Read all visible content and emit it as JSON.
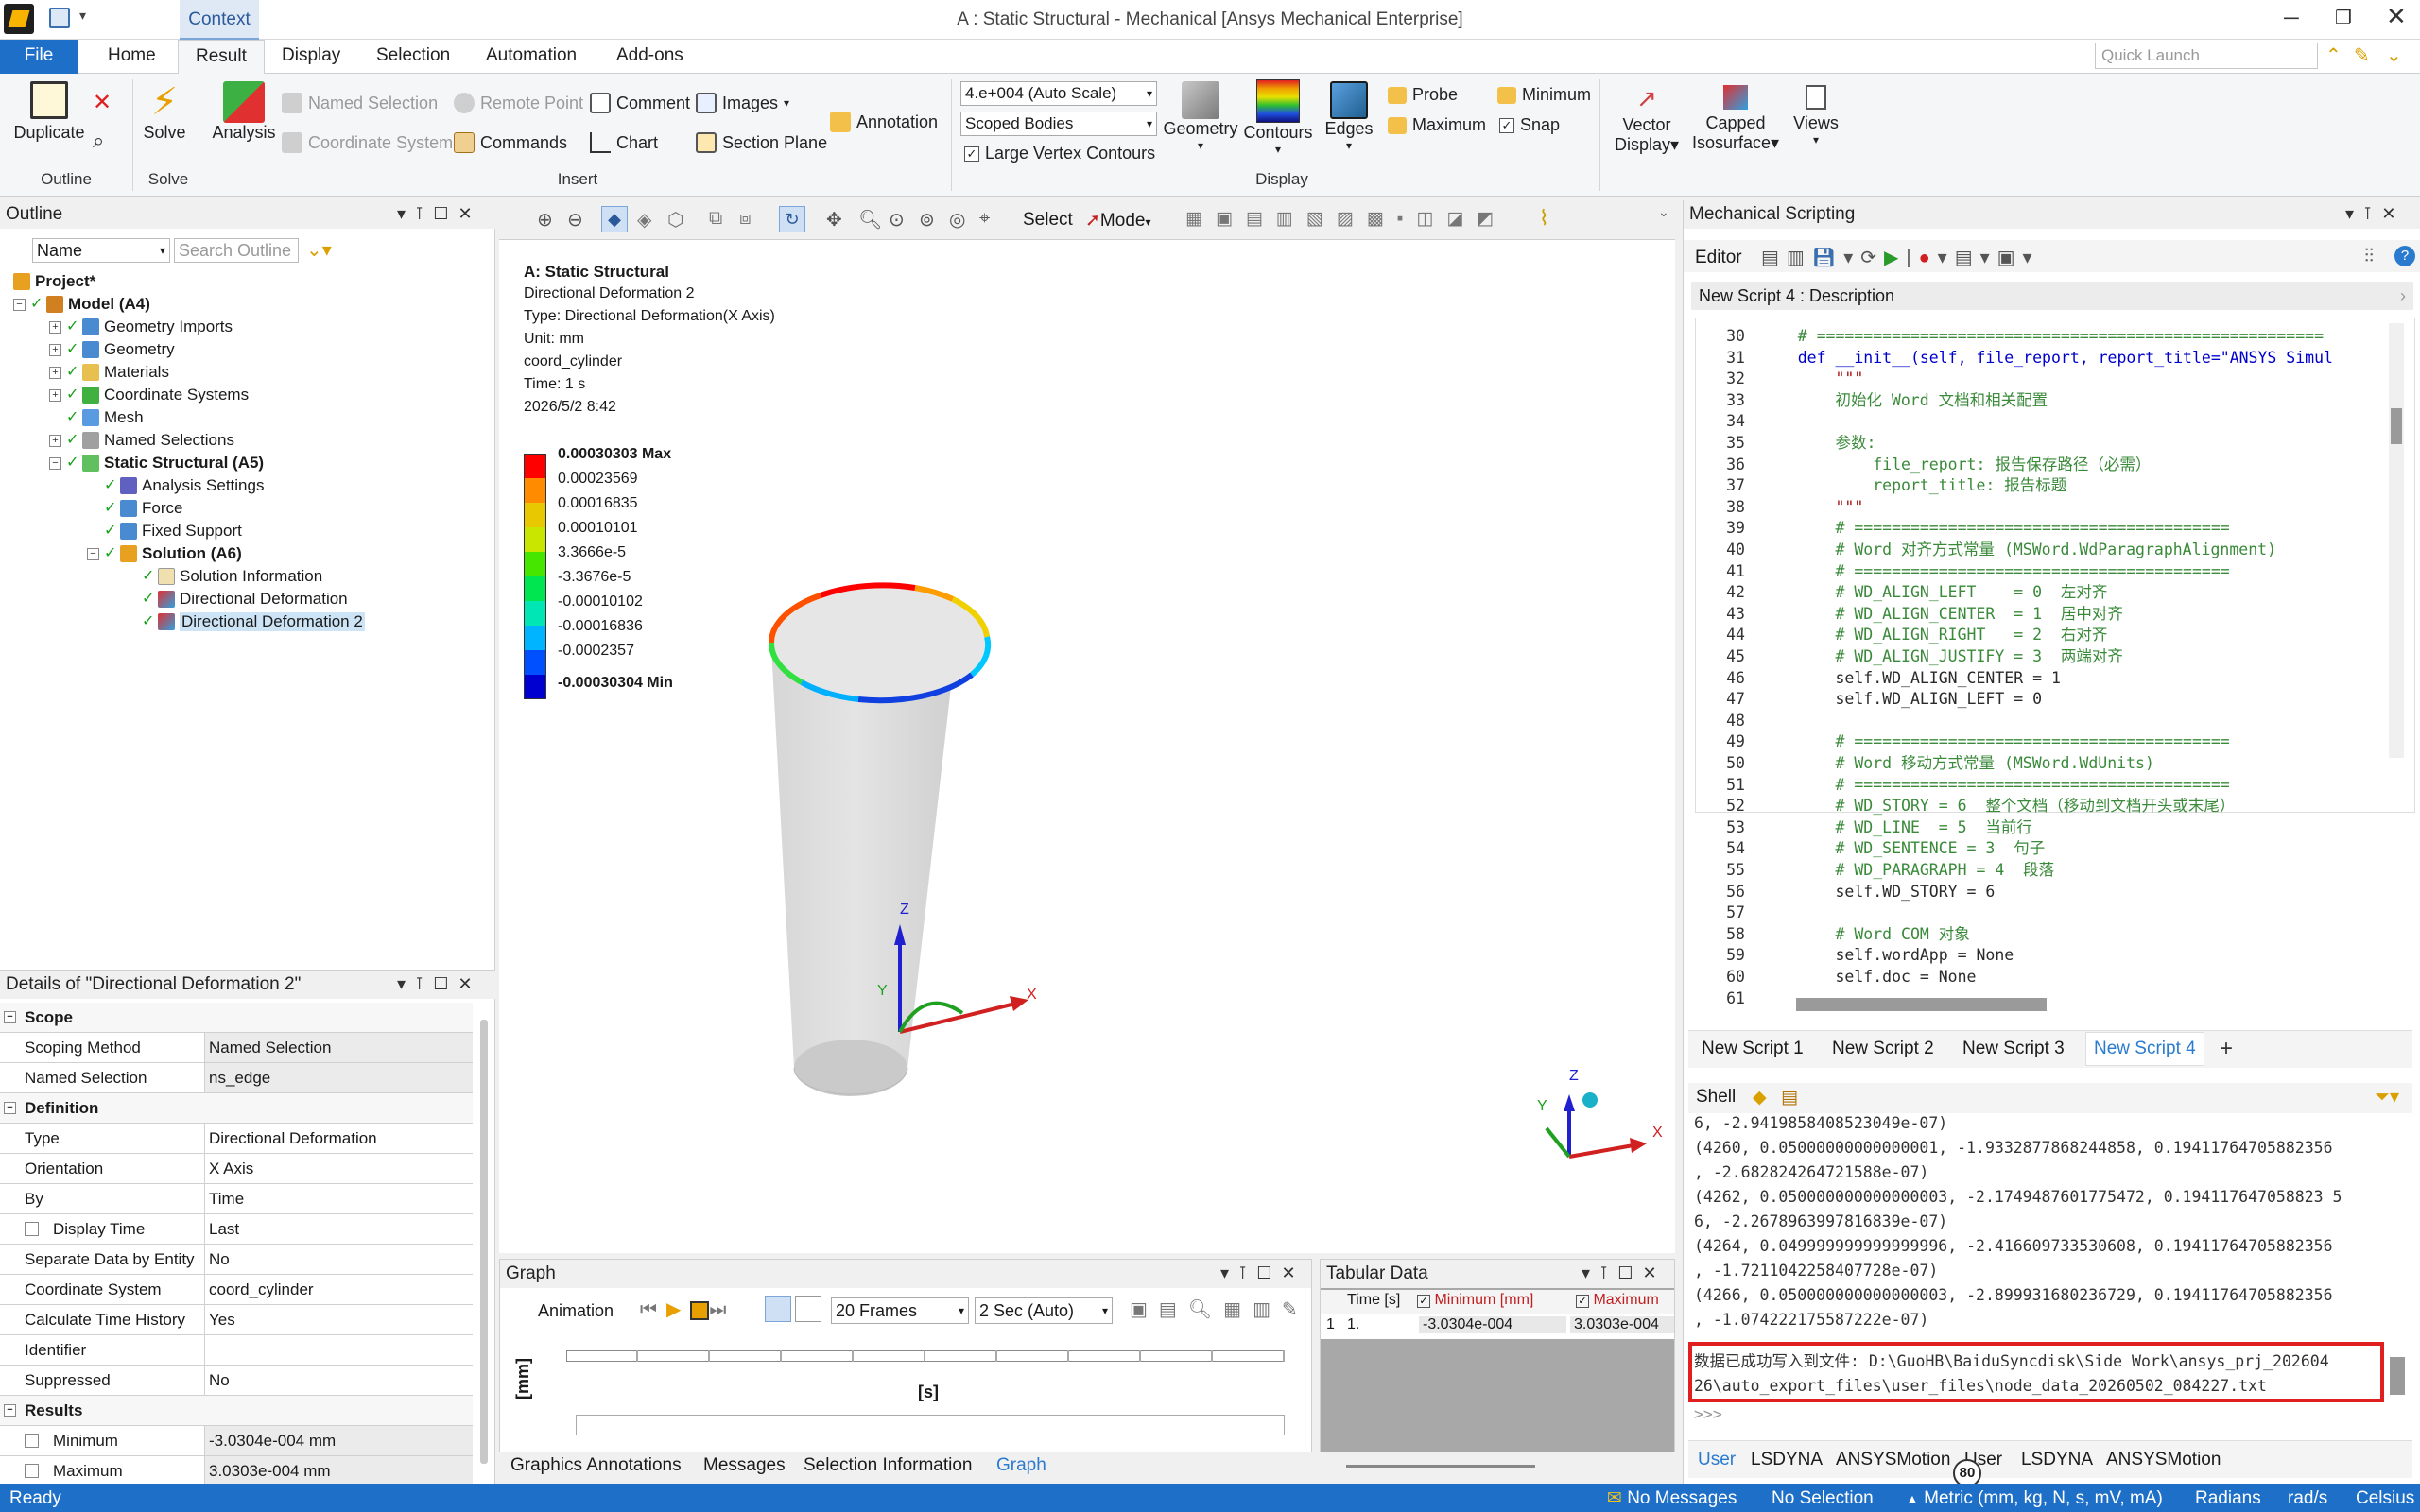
{
  "window": {
    "title": "A : Static Structural - Mechanical [Ansys Mechanical Enterprise]",
    "context_tab": "Context",
    "quick_launch_placeholder": "Quick Launch"
  },
  "ribbon_tabs": [
    "File",
    "Home",
    "Result",
    "Display",
    "Selection",
    "Automation",
    "Add-ons"
  ],
  "ribbon": {
    "duplicate": "Duplicate",
    "solve": "Solve",
    "analysis": "Analysis",
    "named_selection": "Named Selection",
    "coordinate_system": "Coordinate System",
    "remote_point": "Remote Point",
    "commands": "Commands",
    "comment": "Comment",
    "chart": "Chart",
    "images": "Images",
    "section_plane": "Section Plane",
    "annotation": "Annotation",
    "scale_value": "4.e+004 (Auto Scale)",
    "scope_value": "Scoped Bodies",
    "large_vertex": "Large Vertex Contours",
    "geometry": "Geometry",
    "contours": "Contours",
    "edges": "Edges",
    "probe": "Probe",
    "minimum": "Minimum",
    "maximum": "Maximum",
    "snap": "Snap",
    "vector_display_1": "Vector",
    "vector_display_2": "Display",
    "capped_1": "Capped",
    "capped_2": "Isosurface",
    "views": "Views",
    "groups": [
      "Outline",
      "Solve",
      "Insert",
      "Display"
    ]
  },
  "outline": {
    "title": "Outline",
    "filter_value": "Name",
    "search_placeholder": "Search Outline",
    "tree": [
      {
        "label": "Project*"
      },
      {
        "label": "Model (A4)"
      },
      {
        "label": "Geometry Imports"
      },
      {
        "label": "Geometry"
      },
      {
        "label": "Materials"
      },
      {
        "label": "Coordinate Systems"
      },
      {
        "label": "Mesh"
      },
      {
        "label": "Named Selections"
      },
      {
        "label": "Static Structural (A5)"
      },
      {
        "label": "Analysis Settings"
      },
      {
        "label": "Force"
      },
      {
        "label": "Fixed Support"
      },
      {
        "label": "Solution (A6)"
      },
      {
        "label": "Solution Information"
      },
      {
        "label": "Directional Deformation"
      },
      {
        "label": "Directional Deformation 2"
      }
    ]
  },
  "details": {
    "title": "Details of \"Directional Deformation 2\"",
    "rows": [
      {
        "k": "Scope",
        "v": ""
      },
      {
        "k": "Scoping Method",
        "v": "Named Selection"
      },
      {
        "k": "Named Selection",
        "v": "ns_edge"
      },
      {
        "k": "Definition",
        "v": ""
      },
      {
        "k": "Type",
        "v": "Directional Deformation"
      },
      {
        "k": "Orientation",
        "v": "X Axis"
      },
      {
        "k": "By",
        "v": "Time"
      },
      {
        "k": "Display Time",
        "v": "Last"
      },
      {
        "k": "Separate Data by Entity",
        "v": "No"
      },
      {
        "k": "Coordinate System",
        "v": "coord_cylinder"
      },
      {
        "k": "Calculate Time History",
        "v": "Yes"
      },
      {
        "k": "Identifier",
        "v": ""
      },
      {
        "k": "Suppressed",
        "v": "No"
      },
      {
        "k": "Results",
        "v": ""
      },
      {
        "k": "Minimum",
        "v": "-3.0304e-004 mm"
      },
      {
        "k": "Maximum",
        "v": "3.0303e-004 mm"
      }
    ]
  },
  "toolbar": {
    "select": "Select",
    "mode": "Mode"
  },
  "viewport": {
    "info": [
      "A: Static Structural",
      "Directional Deformation 2",
      "Type: Directional Deformation(X Axis)",
      "Unit: mm",
      "coord_cylinder",
      "Time: 1 s",
      "2026/5/2 8:42"
    ],
    "legend": [
      "0.00030303 Max",
      "0.00023569",
      "0.00016835",
      "0.00010101",
      "3.3666e-5",
      "-3.3676e-5",
      "-0.00010102",
      "-0.00016836",
      "-0.0002357",
      "-0.00030304 Min"
    ],
    "legend_colors": [
      "#ff0000",
      "#ff8c00",
      "#e8c800",
      "#c8e600",
      "#46e600",
      "#00e650",
      "#00e6b4",
      "#00b4ff",
      "#0050ff",
      "#0000d0"
    ],
    "axis_x": "X",
    "axis_y": "Y",
    "axis_z": "Z"
  },
  "graph": {
    "title": "Graph",
    "animation": "Animation",
    "frames": "20 Frames",
    "duration": "2 Sec (Auto)",
    "y_label": "[mm]",
    "x_label": "[s]"
  },
  "tabular": {
    "title": "Tabular Data",
    "headers": [
      "Time [s]",
      "Minimum [mm]",
      "Maximum"
    ],
    "row": [
      "1",
      "1.",
      "-3.0304e-004",
      "3.0303e-004"
    ]
  },
  "bottom_tabs": [
    "Graphics Annotations",
    "Messages",
    "Selection Information",
    "Graph"
  ],
  "scripting": {
    "title": "Mechanical Scripting",
    "editor": "Editor",
    "description": "New Script 4 : Description",
    "lines": [
      {
        "n": "30",
        "t": "    # ======================================================"
      },
      {
        "n": "31",
        "t": "    def __init__(self, file_report, report_title=\"ANSYS Simul"
      },
      {
        "n": "32",
        "t": "        \"\"\""
      },
      {
        "n": "33",
        "t": "        初始化 Word 文档和相关配置"
      },
      {
        "n": "34",
        "t": ""
      },
      {
        "n": "35",
        "t": "        参数:"
      },
      {
        "n": "36",
        "t": "            file_report: 报告保存路径（必需）"
      },
      {
        "n": "37",
        "t": "            report_title: 报告标题"
      },
      {
        "n": "38",
        "t": "        \"\"\""
      },
      {
        "n": "39",
        "t": "        # ========================================"
      },
      {
        "n": "40",
        "t": "        # Word 对齐方式常量 (MSWord.WdParagraphAlignment)"
      },
      {
        "n": "41",
        "t": "        # ========================================"
      },
      {
        "n": "42",
        "t": "        # WD_ALIGN_LEFT    = 0  左对齐"
      },
      {
        "n": "43",
        "t": "        # WD_ALIGN_CENTER  = 1  居中对齐"
      },
      {
        "n": "44",
        "t": "        # WD_ALIGN_RIGHT   = 2  右对齐"
      },
      {
        "n": "45",
        "t": "        # WD_ALIGN_JUSTIFY = 3  两端对齐"
      },
      {
        "n": "46",
        "t": "        self.WD_ALIGN_CENTER = 1"
      },
      {
        "n": "47",
        "t": "        self.WD_ALIGN_LEFT = 0"
      },
      {
        "n": "48",
        "t": ""
      },
      {
        "n": "49",
        "t": "        # ========================================"
      },
      {
        "n": "50",
        "t": "        # Word 移动方式常量 (MSWord.WdUnits)"
      },
      {
        "n": "51",
        "t": "        # ========================================"
      },
      {
        "n": "52",
        "t": "        # WD_STORY = 6  整个文档（移动到文档开头或末尾）"
      },
      {
        "n": "53",
        "t": "        # WD_LINE  = 5  当前行"
      },
      {
        "n": "54",
        "t": "        # WD_SENTENCE = 3  句子"
      },
      {
        "n": "55",
        "t": "        # WD_PARAGRAPH = 4  段落"
      },
      {
        "n": "56",
        "t": "        self.WD_STORY = 6"
      },
      {
        "n": "57",
        "t": ""
      },
      {
        "n": "58",
        "t": "        # Word COM 对象"
      },
      {
        "n": "59",
        "t": "        self.wordApp = None"
      },
      {
        "n": "60",
        "t": "        self.doc = None"
      },
      {
        "n": "61",
        "t": ""
      }
    ],
    "script_tabs": [
      "New Script 1",
      "New Script 2",
      "New Script 3",
      "New Script 4"
    ],
    "shell_title": "Shell",
    "shell_lines": [
      "6, -2.9419858408523049e-07)",
      "(4260, 0.05000000000000001, -1.9332877868244858, 0.19411764705882356",
      ", -2.682824264721588e-07)",
      "(4262, 0.050000000000000003, -2.1749487601775472, 0.194117647058823 5",
      "6, -2.2678963997816839e-07)",
      "(4264, 0.049999999999999996, -2.416609733530608, 0.19411764705882356",
      ", -1.7211042258407728e-07)",
      "(4266, 0.050000000000000003, -2.899931680236729, 0.19411764705882356",
      ", -1.074222175587222e-07)"
    ],
    "shell_result_1": "数据已成功写入到文件: D:\\GuoHB\\BaiduSyncdisk\\Side Work\\ansys_prj_202604",
    "shell_result_2": "26\\auto_export_files\\user_files\\node_data_20260502_084227.txt",
    "prompt": ">>>",
    "bottom_tabs": [
      "User",
      "LSDYNA",
      "ANSYSMotion",
      "User",
      "LSDYNA",
      "ANSYSMotion"
    ],
    "badge": "80"
  },
  "status": {
    "ready": "Ready",
    "messages": "No Messages",
    "selection": "No Selection",
    "units": "Metric (mm, kg, N, s, mV, mA)",
    "angle": "Radians",
    "rate": "rad/s",
    "temp": "Celsius"
  }
}
